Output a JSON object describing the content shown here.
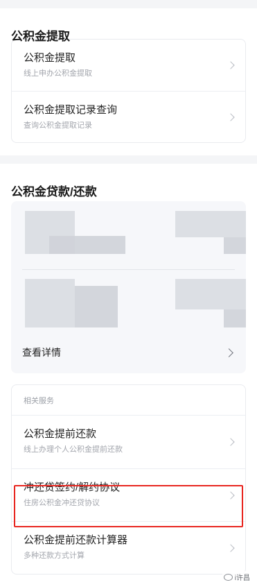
{
  "withdraw": {
    "title": "公积金提取",
    "items": [
      {
        "label": "公积金提取",
        "sub": "线上申办公积金提取"
      },
      {
        "label": "公积金提取记录查询",
        "sub": "查询公积金提取记录"
      }
    ]
  },
  "loan": {
    "title": "公积金贷款/还款",
    "detail_label": "查看详情"
  },
  "services": {
    "header": "相关服务",
    "items": [
      {
        "label": "公积金提前还款",
        "sub": "线上办理个人公积金提前还款"
      },
      {
        "label": "冲还贷签约/解约协议",
        "sub": "住房公积金冲还贷协议"
      },
      {
        "label": "公积金提前还款计算器",
        "sub": "多种还款方式计算"
      }
    ]
  },
  "watermark": "i许昌",
  "colors": {
    "highlight": "#e8251f",
    "divider": "#f4f5f7"
  }
}
